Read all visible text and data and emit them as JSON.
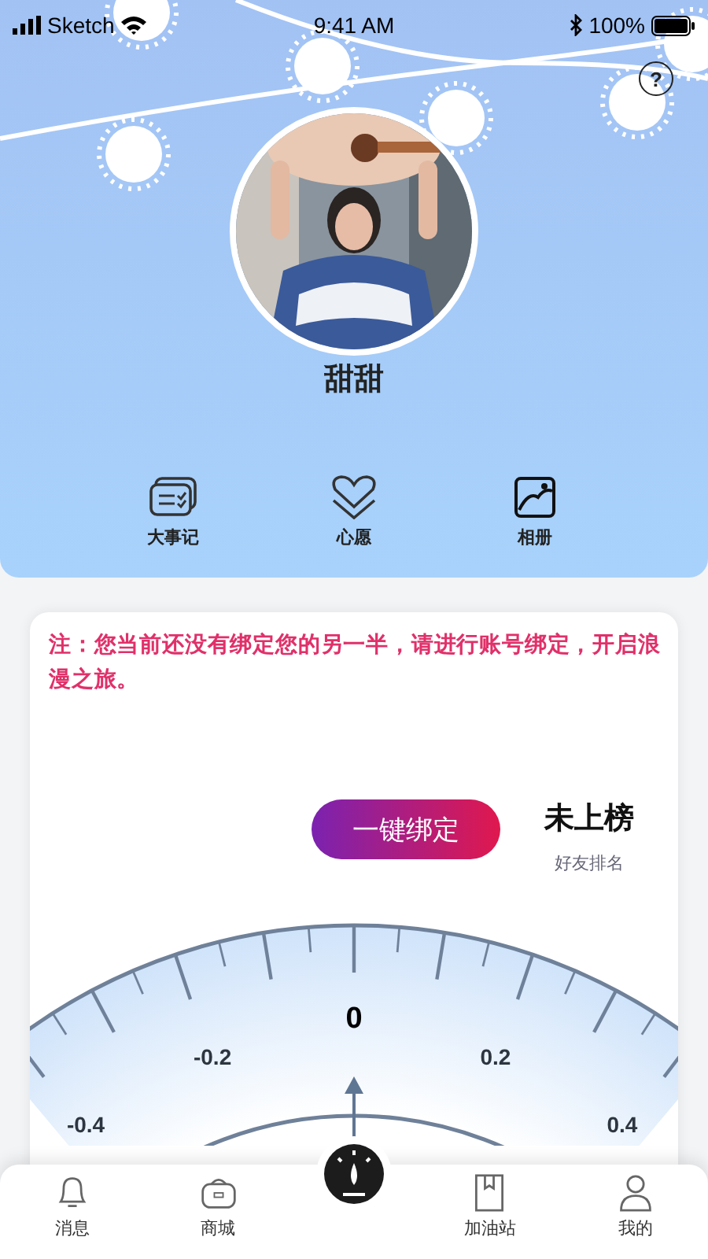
{
  "status_bar": {
    "carrier": "Sketch",
    "time": "9:41 AM",
    "battery": "100%"
  },
  "header": {
    "help": "?",
    "name": "甜甜",
    "shortcuts": [
      {
        "label": "大事记"
      },
      {
        "label": "心愿"
      },
      {
        "label": "相册"
      }
    ]
  },
  "card": {
    "notice": "注：您当前还没有绑定您的另一半，请进行账号绑定，开启浪漫之旅。",
    "bind_button": "一键绑定",
    "rank": "未上榜",
    "rank_caption": "好友排名",
    "gauge": {
      "labels": [
        "-0.4",
        "-0.2",
        "0",
        "0.2",
        "0.4"
      ],
      "level": 0.5
    }
  },
  "tab_bar": [
    {
      "kind": "tab",
      "label": "消息"
    },
    {
      "kind": "tab",
      "label": "商城"
    },
    {
      "kind": "center"
    },
    {
      "kind": "tab",
      "label": "加油站"
    },
    {
      "kind": "tab",
      "label": "我的"
    }
  ]
}
